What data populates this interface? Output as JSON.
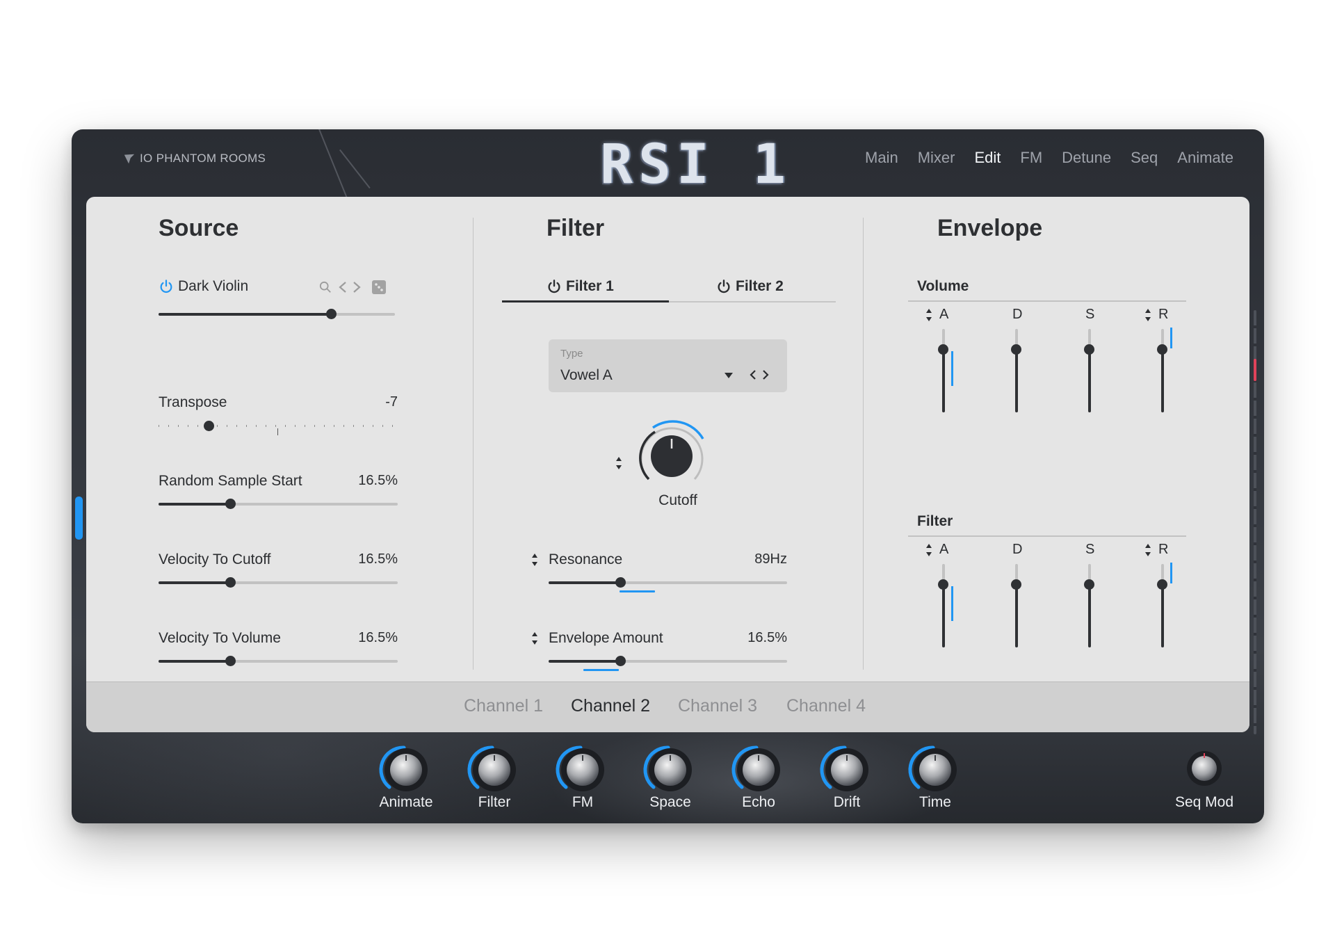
{
  "header": {
    "brand": "IO PHANTOM ROOMS",
    "title": "RSI 1",
    "nav": [
      "Main",
      "Mixer",
      "Edit",
      "FM",
      "Detune",
      "Seq",
      "Animate"
    ],
    "active_nav": "Edit"
  },
  "source": {
    "title": "Source",
    "sample": "Dark Violin",
    "sample_level": 0.73,
    "params": [
      {
        "label": "Transpose",
        "value": "-7",
        "position": 0.21
      },
      {
        "label": "Random Sample Start",
        "value": "16.5%",
        "position": 0.3
      },
      {
        "label": "Velocity To Cutoff",
        "value": "16.5%",
        "position": 0.3
      },
      {
        "label": "Velocity To Volume",
        "value": "16.5%",
        "position": 0.3
      }
    ]
  },
  "filter": {
    "title": "Filter",
    "tabs": [
      "Filter 1",
      "Filter 2"
    ],
    "active_tab": "Filter 1",
    "type_label": "Type",
    "type_value": "Vowel A",
    "knob_label": "Cutoff",
    "resonance": {
      "label": "Resonance",
      "value": "89Hz",
      "position": 0.3
    },
    "envelope_amount": {
      "label": "Envelope Amount",
      "value": "16.5%",
      "position": 0.3
    }
  },
  "envelope": {
    "title": "Envelope",
    "volume": {
      "title": "Volume",
      "labels": [
        "A",
        "D",
        "S",
        "R"
      ]
    },
    "filter": {
      "title": "Filter",
      "labels": [
        "A",
        "D",
        "S",
        "R"
      ]
    }
  },
  "channels": {
    "items": [
      "Channel 1",
      "Channel 2",
      "Channel 3",
      "Channel 4"
    ],
    "active": "Channel 2"
  },
  "macros": [
    "Animate",
    "Filter",
    "FM",
    "Space",
    "Echo",
    "Drift",
    "Time"
  ],
  "seq_mod": "Seq Mod",
  "colors": {
    "accent": "#2196f3",
    "panel": "#e5e5e5",
    "frame": "#33363c",
    "text": "#2b2d30"
  }
}
